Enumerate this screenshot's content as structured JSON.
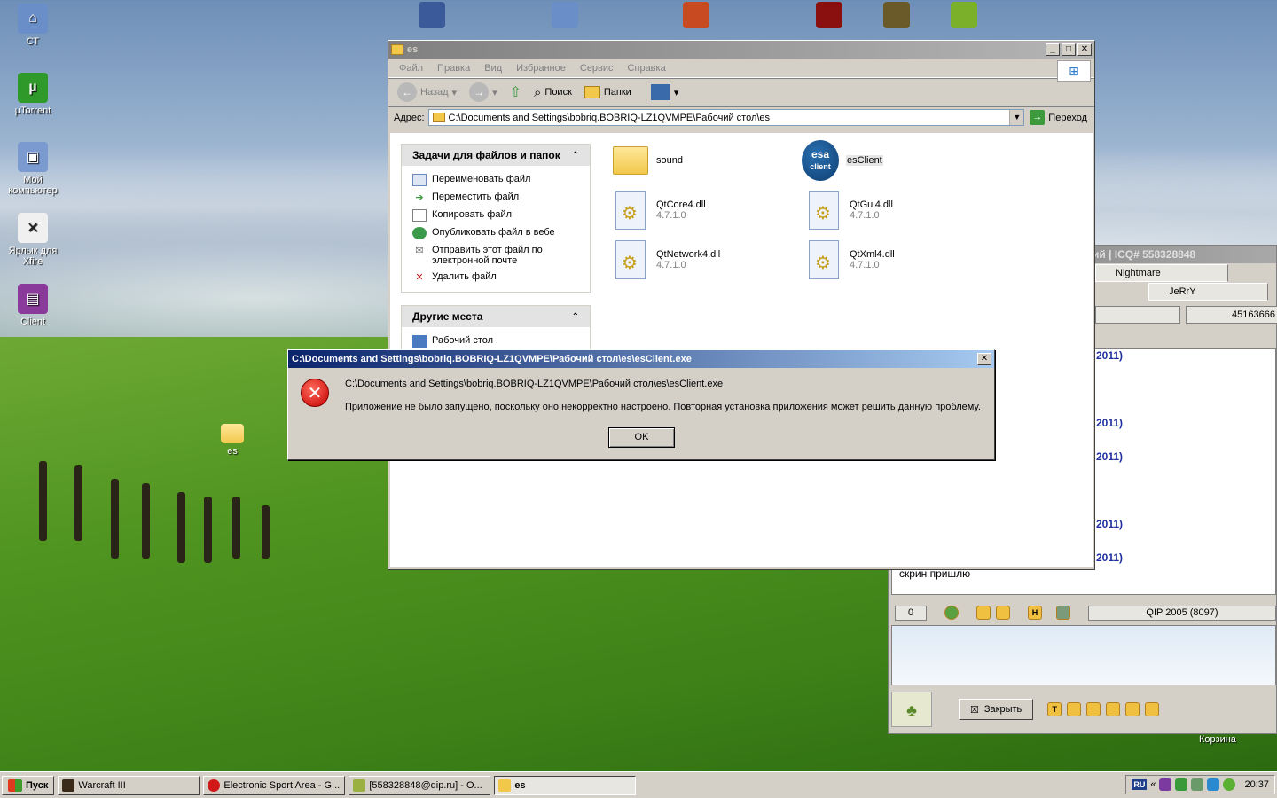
{
  "desktop": {
    "icons": [
      {
        "label": "СТ"
      },
      {
        "label": "µTorrent"
      },
      {
        "label": "Мой компьютер"
      },
      {
        "label": "Ярлык для Xfire"
      },
      {
        "label": "Client"
      },
      {
        "label": "es"
      }
    ],
    "recycle_bin_label": "Корзина"
  },
  "explorer": {
    "title": "es",
    "menu": [
      "Файл",
      "Правка",
      "Вид",
      "Избранное",
      "Сервис",
      "Справка"
    ],
    "toolbar": {
      "back_label": "Назад",
      "search_label": "Поиск",
      "folders_label": "Папки"
    },
    "address": {
      "label": "Адрес:",
      "value": "C:\\Documents and Settings\\bobriq.BOBRIQ-LZ1QVMPE\\Рабочий стол\\es",
      "go_label": "Переход"
    },
    "tasks": {
      "title": "Задачи для файлов и папок",
      "items": [
        {
          "label": "Переименовать файл",
          "icon": "rename-icon"
        },
        {
          "label": "Переместить файл",
          "icon": "move-icon"
        },
        {
          "label": "Копировать файл",
          "icon": "copy-icon"
        },
        {
          "label": "Опубликовать файл в вебе",
          "icon": "globe-icon"
        },
        {
          "label": "Отправить этот файл по электронной почте",
          "icon": "email-icon"
        },
        {
          "label": "Удалить файл",
          "icon": "delete-icon"
        }
      ]
    },
    "other_places": {
      "title": "Другие места",
      "items": [
        {
          "label": "Рабочий стол"
        }
      ]
    },
    "files": [
      {
        "name": "sound",
        "version": "",
        "type": "folder"
      },
      {
        "name": "esClient",
        "version": "",
        "type": "exe"
      },
      {
        "name": "QtCore4.dll",
        "version": "4.7.1.0",
        "type": "dll"
      },
      {
        "name": "QtGui4.dll",
        "version": "4.7.1.0",
        "type": "dll"
      },
      {
        "name": "QtNetwork4.dll",
        "version": "4.7.1.0",
        "type": "dll"
      },
      {
        "name": "QtXml4.dll",
        "version": "4.7.1.0",
        "type": "dll"
      }
    ]
  },
  "qip": {
    "title": "ий | ICQ# 558328848",
    "tabs": [
      "Nightmare",
      "JeRrY"
    ],
    "uin_field": "45163666",
    "chat_dates": [
      "2011)",
      "2011)",
      "2011)",
      "2011)",
      "2011)"
    ],
    "chat_message": "скрин пришлю",
    "counter": "0",
    "version": "QIP 2005 (8097)",
    "close_label": "Закрыть"
  },
  "dialog": {
    "title": "C:\\Documents and Settings\\bobriq.BOBRIQ-LZ1QVMPE\\Рабочий стол\\es\\esClient.exe",
    "path_line": "C:\\Documents and Settings\\bobriq.BOBRIQ-LZ1QVMPE\\Рабочий стол\\es\\esClient.exe",
    "message": "Приложение не было запущено, поскольку оно некорректно настроено. Повторная установка приложения может решить данную проблему.",
    "ok_label": "OK"
  },
  "taskbar": {
    "start_label": "Пуск",
    "tasks": [
      {
        "label": "Warcraft III"
      },
      {
        "label": "Electronic Sport Area - G..."
      },
      {
        "label": "[558328848@qip.ru] - О..."
      },
      {
        "label": "es"
      }
    ],
    "lang": "RU",
    "clock": "20:37"
  }
}
